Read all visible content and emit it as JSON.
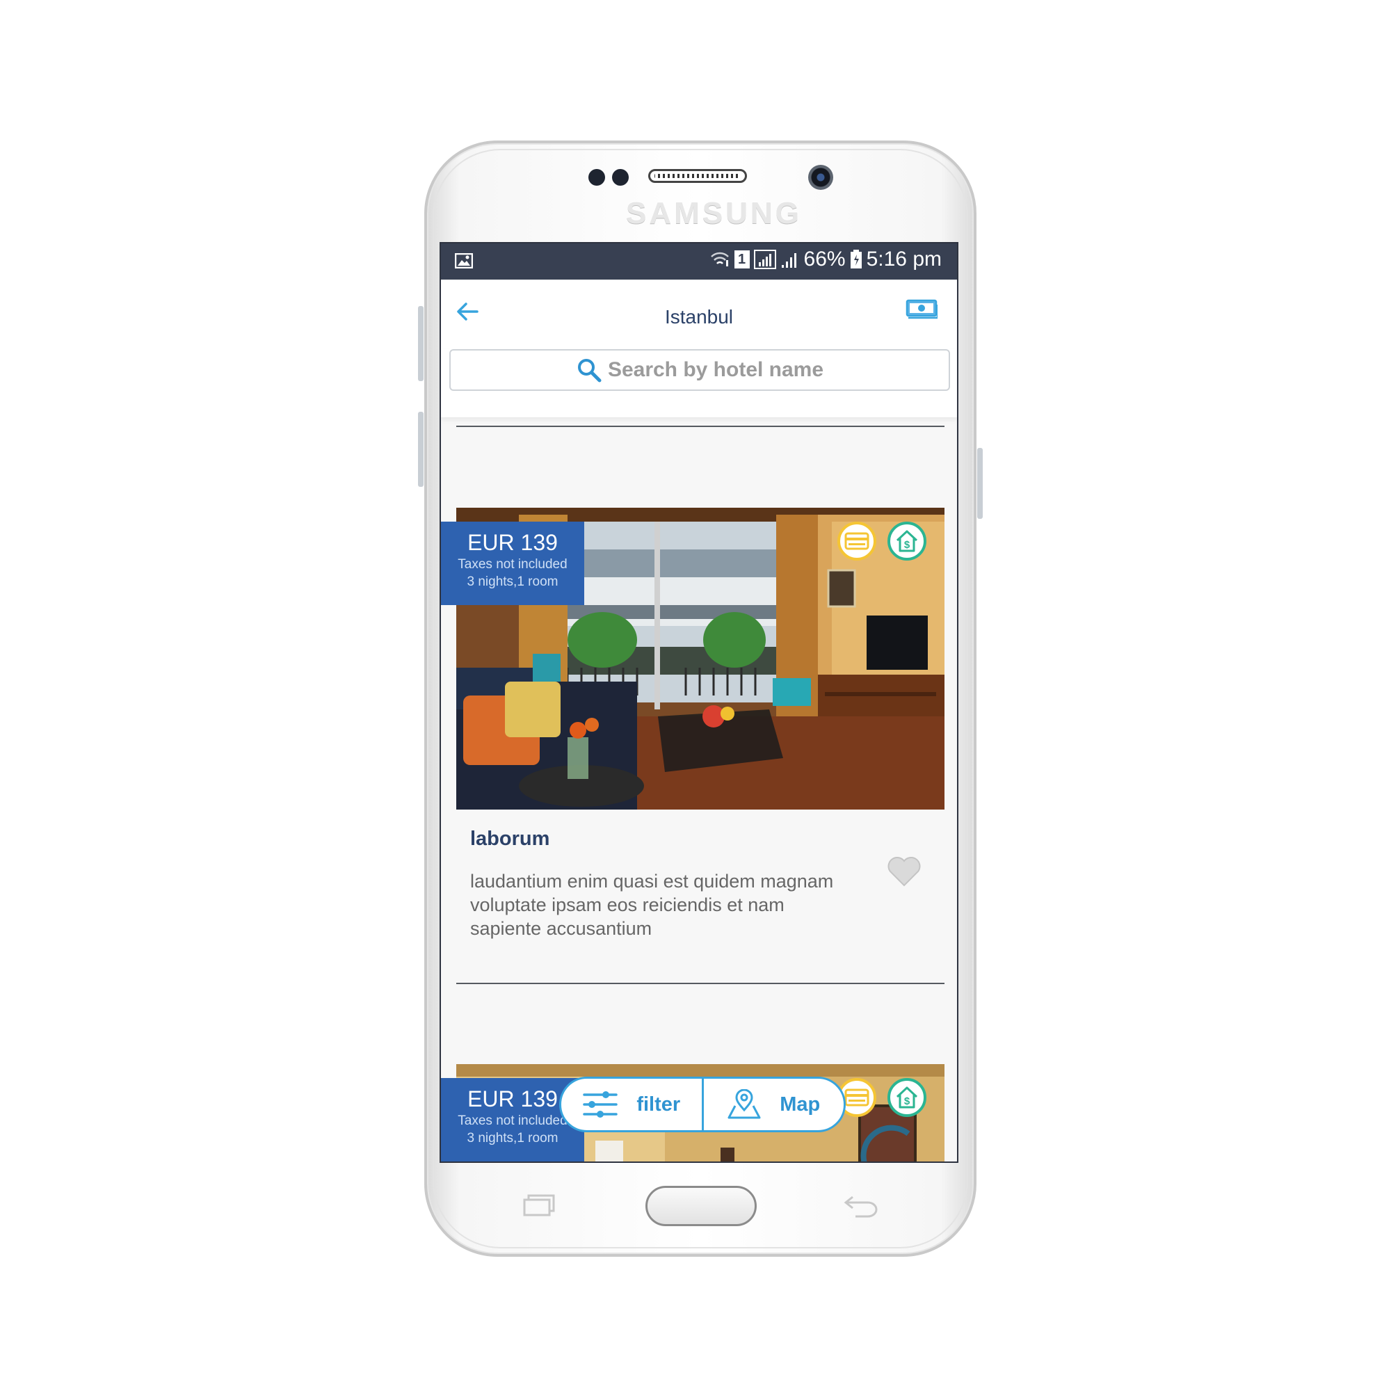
{
  "device": {
    "brand": "SAMSUNG"
  },
  "status_bar": {
    "battery": "66%",
    "time": "5:16 pm",
    "sim_slot": "1"
  },
  "header": {
    "title": "Istanbul"
  },
  "search": {
    "placeholder": "Search by hotel name"
  },
  "hotels": [
    {
      "price": "EUR 139",
      "tax_note": "Taxes not included",
      "stay": "3 nights,1 room",
      "name": "laborum",
      "description": "laudantium enim quasi est quidem magnam voluptate ipsam eos reiciendis et nam sapiente accusantium",
      "badges": [
        "credit-card-icon",
        "home-dollar-icon"
      ]
    },
    {
      "price": "EUR 139",
      "tax_note": "Taxes not included",
      "stay": "3 nights,1 room",
      "badges": [
        "credit-card-icon",
        "home-dollar-icon"
      ]
    }
  ],
  "actions": {
    "filter_label": "filter",
    "map_label": "Map"
  },
  "colors": {
    "status_bar_bg": "#384052",
    "accent_blue": "#37a4dd",
    "price_tag_bg": "#2e62b0",
    "title_text": "#2b4168",
    "card_badge_yellow": "#f5c534",
    "home_badge_green": "#2bb592"
  }
}
